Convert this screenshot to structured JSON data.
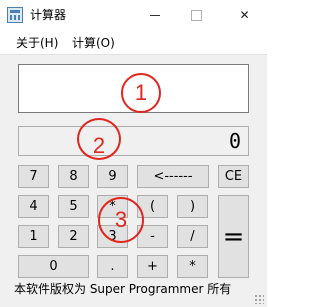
{
  "window": {
    "title": "计算器",
    "close_glyph": "✕"
  },
  "menu": {
    "items": [
      "关于(H)",
      "计算(O)"
    ]
  },
  "display": {
    "expression": "",
    "result": "0"
  },
  "buttons": {
    "row1": [
      "7",
      "8",
      "9",
      "<------",
      "CE"
    ],
    "row2": [
      "4",
      "5",
      "*",
      "(",
      ")"
    ],
    "row3": [
      "1",
      "2",
      "3",
      "-",
      "/"
    ],
    "row4": [
      "0",
      ".",
      "+",
      "*"
    ],
    "equals": "="
  },
  "annotations": {
    "marker_1": "1",
    "marker_2": "2",
    "marker_3": "3",
    "color": "#e0261f"
  },
  "status": {
    "text": "本软件版权为 Super Programmer 所有"
  }
}
